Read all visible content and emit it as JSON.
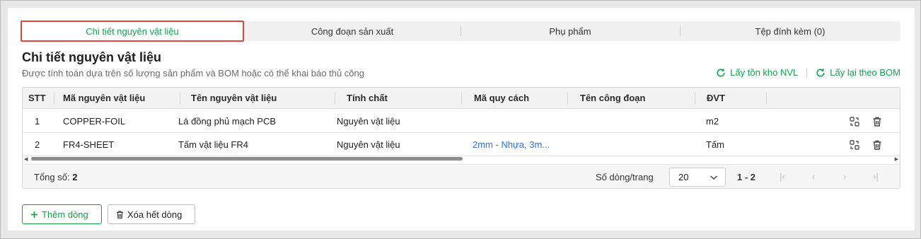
{
  "tabs": [
    {
      "label": "Chi tiết nguyên vật liệu",
      "active": true
    },
    {
      "label": "Công đoạn sản xuất",
      "active": false
    },
    {
      "label": "Phụ phẩm",
      "active": false
    },
    {
      "label": "Tệp đính kèm (0)",
      "active": false
    }
  ],
  "section": {
    "title": "Chi tiết nguyên vật liệu",
    "subtitle": "Được tính toán dựa trên số lượng sản phẩm và BOM hoặc có thể khai báo thủ công"
  },
  "actions": {
    "get_stock": "Lấy tồn kho NVL",
    "reload_bom": "Lấy lại theo BOM"
  },
  "table": {
    "columns": [
      "STT",
      "Mã nguyên vật liệu",
      "Tên nguyên vật liệu",
      "Tính chất",
      "Mã quy cách",
      "Tên công đoạn",
      "ĐVT"
    ],
    "rows": [
      {
        "stt": "1",
        "code": "COPPER-FOIL",
        "name": "Lá đồng phủ mạch PCB",
        "property": "Nguyên vật liệu",
        "spec": "",
        "stage": "",
        "unit": "m2"
      },
      {
        "stt": "2",
        "code": "FR4-SHEET",
        "name": "Tấm vật liệu FR4",
        "property": "Nguyên vật liệu",
        "spec": "2mm - Nhựa, 3m...",
        "stage": "",
        "unit": "Tấm"
      }
    ]
  },
  "footer": {
    "total_label": "Tổng số:",
    "total_value": "2",
    "per_page_label": "Số dòng/trang",
    "per_page_value": "20",
    "range": "1 - 2"
  },
  "buttons": {
    "add_row": "Thêm dòng",
    "delete_all": "Xóa hết dòng"
  },
  "colors": {
    "accent": "#12a34a",
    "active_tab_border": "#e0463e",
    "link": "#2f6fd6"
  }
}
